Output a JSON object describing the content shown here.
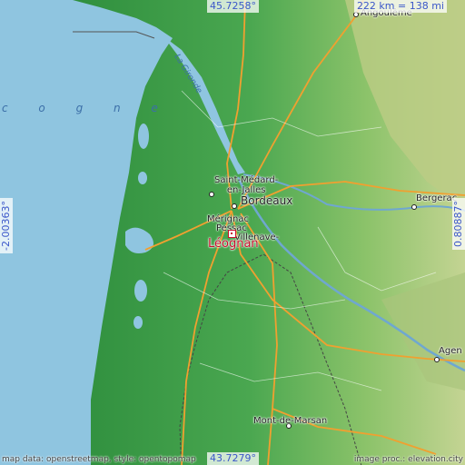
{
  "map": {
    "sea_name": "c o g n e",
    "river_name": "La Gironde",
    "focus_town": "Léognan",
    "places": [
      {
        "id": "angouleme",
        "name": "Angoulême"
      },
      {
        "id": "saint-medard",
        "name": "Saint-Médard-\nen-Jalles"
      },
      {
        "id": "bordeaux",
        "name": "Bordeaux"
      },
      {
        "id": "merignac",
        "name": "Mérignac"
      },
      {
        "id": "pessac",
        "name": "Pessac"
      },
      {
        "id": "villenave",
        "name": "Villenave-"
      },
      {
        "id": "bergerac",
        "name": "Bergerac"
      },
      {
        "id": "agen",
        "name": "Agen"
      },
      {
        "id": "mont-de-marsan",
        "name": "Mont-de-Marsan"
      }
    ],
    "lat_top": "45.7258°",
    "lat_bottom": "43.7279°",
    "lon_left": "-2.00363°",
    "lon_right": "0.80887°",
    "scale": "222 km = 138 mi",
    "credit_left": "map data: openstreetmap, style: opentopomap",
    "credit_right": "image proc.: elevation.city"
  },
  "colors": {
    "sea": "#8fc5e0",
    "lowland": "#3f9c4a",
    "upland": "#c9d59a",
    "road": "#f0a030",
    "focus": "#c8102e",
    "coord_text": "#3b57c9"
  }
}
